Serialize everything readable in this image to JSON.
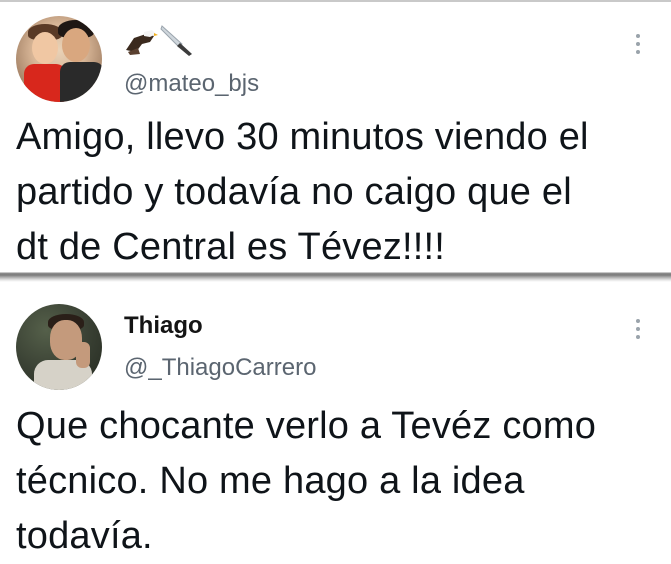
{
  "tweets": [
    {
      "handle": "@mateo_bjs",
      "name_emojis": [
        "eagle-icon",
        "knife-icon"
      ],
      "text_lines": [
        "Amigo, llevo 30 minutos viendo el",
        "partido y todavía no caigo que el",
        "dt de Central es Tévez!!!!"
      ]
    },
    {
      "name": "Thiago",
      "handle": "@_ThiagoCarrero",
      "text_lines": [
        "Que chocante verlo a Tevéz como",
        "técnico. No me hago a la idea",
        "todavía."
      ]
    }
  ],
  "colors": {
    "text": "#0f1419",
    "handle": "#5b6570",
    "more_icon": "#9aa3ab",
    "background": "#ffffff"
  }
}
